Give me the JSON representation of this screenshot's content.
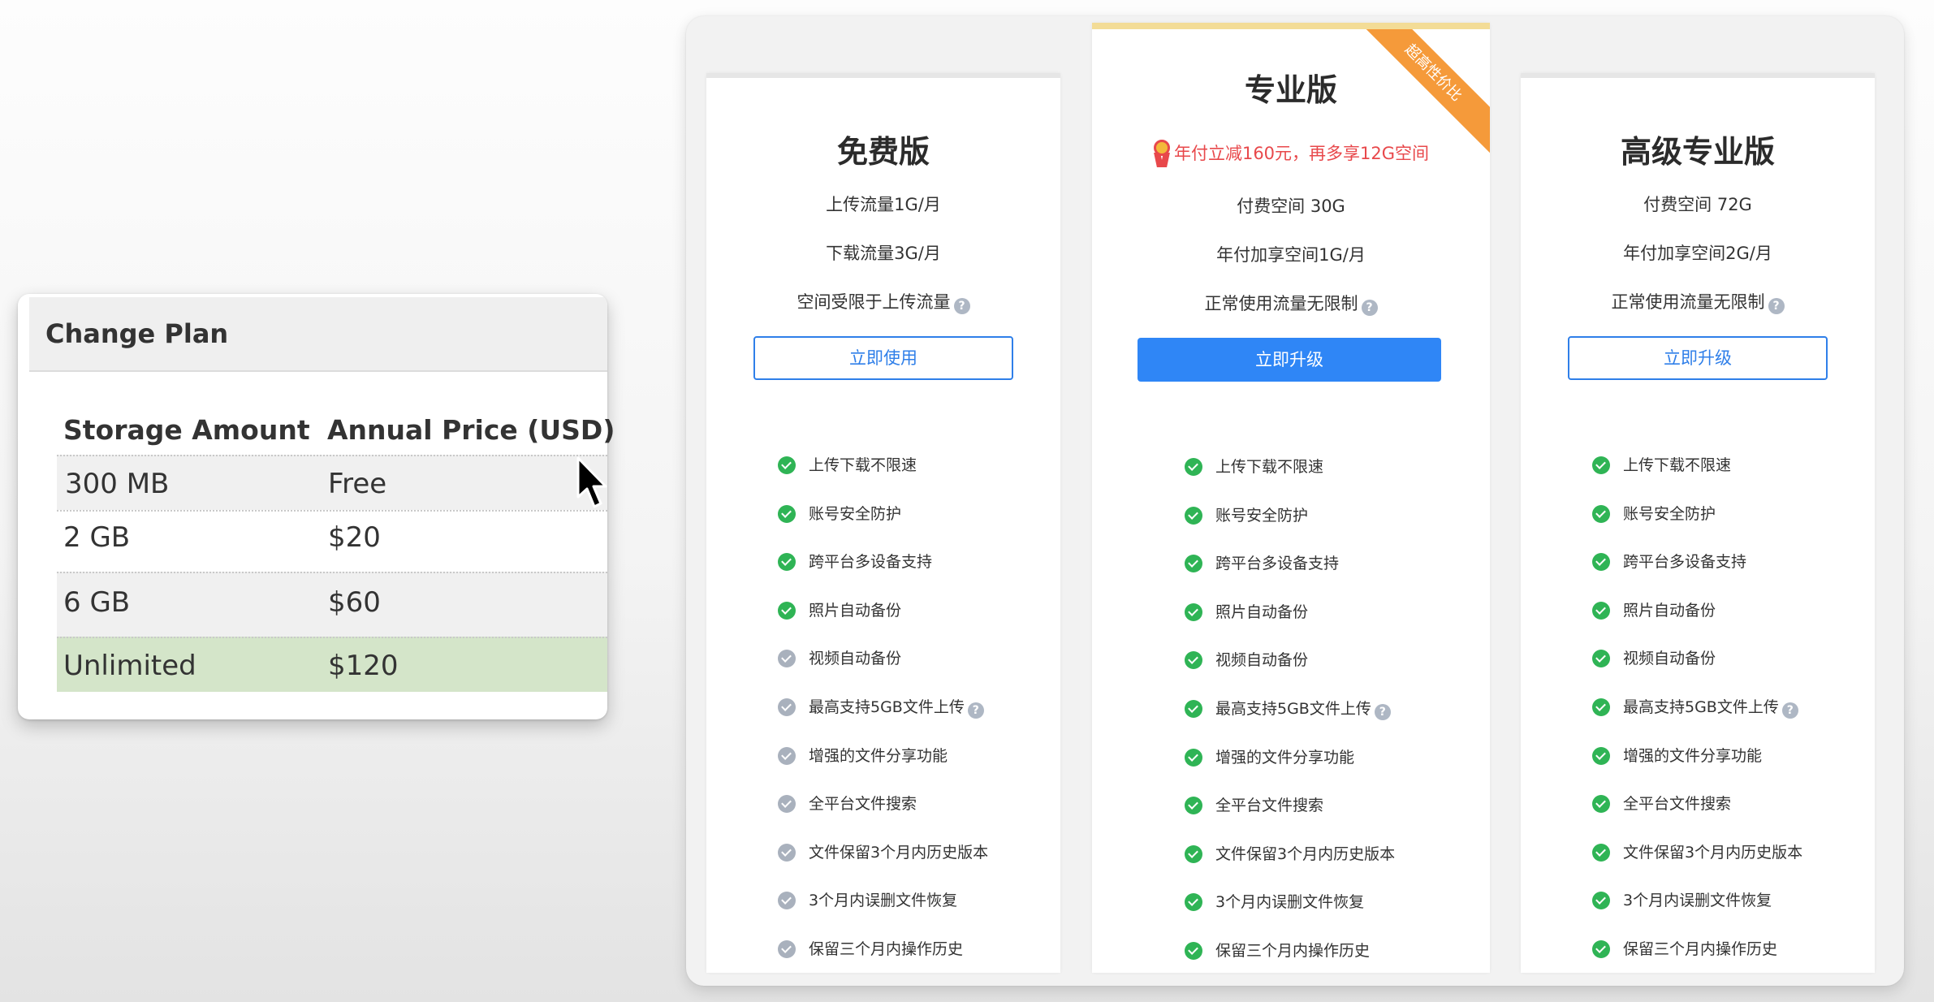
{
  "change_plan": {
    "title": "Change Plan",
    "headers": {
      "storage": "Storage Amount",
      "price": "Annual Price (USD)"
    },
    "rows": [
      {
        "storage": "300 MB",
        "price": "Free"
      },
      {
        "storage": "2 GB",
        "price": "$20"
      },
      {
        "storage": "6 GB",
        "price": "$60"
      },
      {
        "storage": "Unlimited",
        "price": "$120"
      }
    ],
    "highlight_color": "#d4e5c9"
  },
  "plans": [
    {
      "name": "免费版",
      "specs": [
        "上传流量1G/月",
        "下载流量3G/月",
        "空间受限于上传流量"
      ],
      "button": "立即使用"
    },
    {
      "name": "专业版",
      "promo": "年付立减160元，再多享12G空间",
      "specs": [
        "付费空间 30G",
        "年付加享空间1G/月",
        "正常使用流量无限制"
      ],
      "button": "立即升级",
      "ribbon": "超高性价比"
    },
    {
      "name": "高级专业版",
      "specs": [
        "付费空间 72G",
        "年付加享空间2G/月",
        "正常使用流量无限制"
      ],
      "button": "立即升级"
    }
  ],
  "features": [
    "上传下载不限速",
    "账号安全防护",
    "跨平台多设备支持",
    "照片自动备份",
    "视频自动备份",
    "最高支持5GB文件上传",
    "增强的文件分享功能",
    "全平台文件搜索",
    "文件保留3个月内历史版本",
    "3个月内误删文件恢复",
    "保留三个月内操作历史"
  ],
  "free_included_count": 4,
  "colors": {
    "accent_blue": "#2f86f6",
    "check_green": "#2fb455",
    "check_gray": "#a9b1bd",
    "promo_red": "#e8484b",
    "ribbon_orange": "#f59a3a"
  }
}
